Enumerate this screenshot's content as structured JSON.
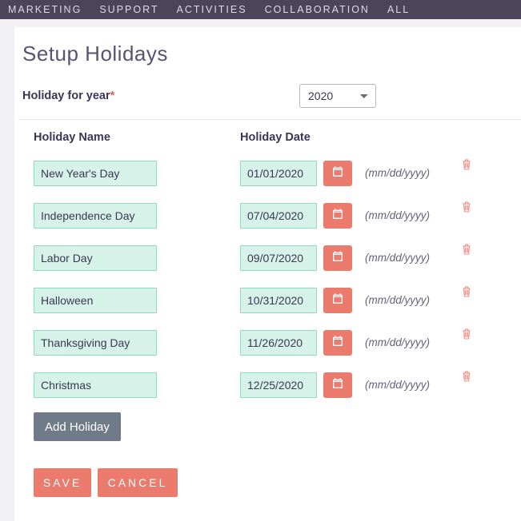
{
  "nav": {
    "items": [
      "MARKETING",
      "SUPPORT",
      "ACTIVITIES",
      "COLLABORATION",
      "ALL"
    ]
  },
  "page_title": "Setup Holidays",
  "year": {
    "label": "Holiday for year",
    "required_marker": "*",
    "value": "2020"
  },
  "table": {
    "headers": {
      "name": "Holiday Name",
      "date": "Holiday Date"
    },
    "hint": "(mm/dd/yyyy)",
    "rows": [
      {
        "name": "New Year's Day",
        "date": "01/01/2020"
      },
      {
        "name": "Independence Day",
        "date": "07/04/2020"
      },
      {
        "name": "Labor Day",
        "date": "09/07/2020"
      },
      {
        "name": "Halloween",
        "date": "10/31/2020"
      },
      {
        "name": "Thanksgiving Day",
        "date": "11/26/2020"
      },
      {
        "name": "Christmas",
        "date": "12/25/2020"
      }
    ]
  },
  "buttons": {
    "add": "Add Holiday",
    "save": "SAVE",
    "cancel": "CANCEL"
  },
  "colors": {
    "brand_purple": "#4b4559",
    "accent": "#eb7b6d",
    "input_bg": "#d7f3e9"
  }
}
